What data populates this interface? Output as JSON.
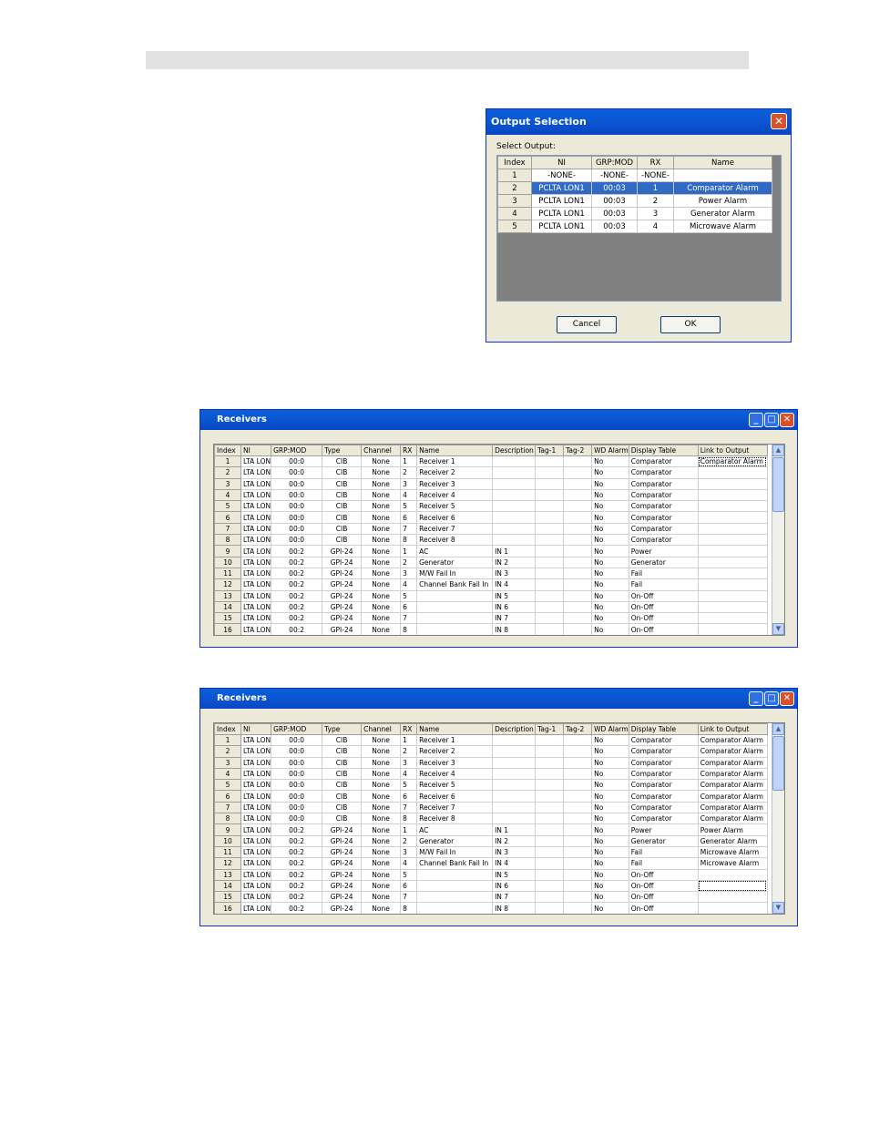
{
  "output_dialog": {
    "title": "Output Selection",
    "label": "Select Output:",
    "columns": [
      "Index",
      "NI",
      "GRP:MOD",
      "RX",
      "Name"
    ],
    "rows": [
      [
        "1",
        "-NONE-",
        "-NONE-",
        "-NONE-",
        ""
      ],
      [
        "2",
        "PCLTA LON1",
        "00:03",
        "1",
        "Comparator Alarm"
      ],
      [
        "3",
        "PCLTA LON1",
        "00:03",
        "2",
        "Power Alarm"
      ],
      [
        "4",
        "PCLTA LON1",
        "00:03",
        "3",
        "Generator Alarm"
      ],
      [
        "5",
        "PCLTA LON1",
        "00:03",
        "4",
        "Microwave Alarm"
      ]
    ],
    "selected_row": 2,
    "cancel_label": "Cancel",
    "ok_label": "OK"
  },
  "receivers_1": {
    "title": "Receivers",
    "columns": [
      "Index",
      "NI",
      "GRP:MOD",
      "Type",
      "Channel",
      "RX",
      "Name",
      "Description",
      "Tag-1",
      "Tag-2",
      "WD Alarm",
      "Display Table",
      "Link to Output"
    ],
    "rows": [
      [
        "1",
        "LTA LON",
        "00:0",
        "CIB",
        "None",
        "1",
        "Receiver 1",
        "",
        "",
        "",
        "No",
        "Comparator",
        "Comparator Alarm"
      ],
      [
        "2",
        "LTA LON",
        "00:0",
        "CIB",
        "None",
        "2",
        "Receiver 2",
        "",
        "",
        "",
        "No",
        "Comparator",
        ""
      ],
      [
        "3",
        "LTA LON",
        "00:0",
        "CIB",
        "None",
        "3",
        "Receiver 3",
        "",
        "",
        "",
        "No",
        "Comparator",
        ""
      ],
      [
        "4",
        "LTA LON",
        "00:0",
        "CIB",
        "None",
        "4",
        "Receiver 4",
        "",
        "",
        "",
        "No",
        "Comparator",
        ""
      ],
      [
        "5",
        "LTA LON",
        "00:0",
        "CIB",
        "None",
        "5",
        "Receiver 5",
        "",
        "",
        "",
        "No",
        "Comparator",
        ""
      ],
      [
        "6",
        "LTA LON",
        "00:0",
        "CIB",
        "None",
        "6",
        "Receiver 6",
        "",
        "",
        "",
        "No",
        "Comparator",
        ""
      ],
      [
        "7",
        "LTA LON",
        "00:0",
        "CIB",
        "None",
        "7",
        "Receiver 7",
        "",
        "",
        "",
        "No",
        "Comparator",
        ""
      ],
      [
        "8",
        "LTA LON",
        "00:0",
        "CIB",
        "None",
        "8",
        "Receiver 8",
        "",
        "",
        "",
        "No",
        "Comparator",
        ""
      ],
      [
        "9",
        "LTA LON",
        "00:2",
        "GPI-24",
        "None",
        "1",
        "AC",
        "IN 1",
        "",
        "",
        "No",
        "Power",
        ""
      ],
      [
        "10",
        "LTA LON",
        "00:2",
        "GPI-24",
        "None",
        "2",
        "Generator",
        "IN 2",
        "",
        "",
        "No",
        "Generator",
        ""
      ],
      [
        "11",
        "LTA LON",
        "00:2",
        "GPI-24",
        "None",
        "3",
        "M/W Fail In",
        "IN 3",
        "",
        "",
        "No",
        "Fail",
        ""
      ],
      [
        "12",
        "LTA LON",
        "00:2",
        "GPI-24",
        "None",
        "4",
        "Channel Bank Fail In",
        "IN 4",
        "",
        "",
        "No",
        "Fail",
        ""
      ],
      [
        "13",
        "LTA LON",
        "00:2",
        "GPI-24",
        "None",
        "5",
        "",
        "IN 5",
        "",
        "",
        "No",
        "On-Off",
        ""
      ],
      [
        "14",
        "LTA LON",
        "00:2",
        "GPI-24",
        "None",
        "6",
        "",
        "IN 6",
        "",
        "",
        "No",
        "On-Off",
        ""
      ],
      [
        "15",
        "LTA LON",
        "00:2",
        "GPI-24",
        "None",
        "7",
        "",
        "IN 7",
        "",
        "",
        "No",
        "On-Off",
        ""
      ],
      [
        "16",
        "LTA LON",
        "00:2",
        "GPI-24",
        "None",
        "8",
        "",
        "IN 8",
        "",
        "",
        "No",
        "On-Off",
        ""
      ]
    ]
  },
  "receivers_2": {
    "title": "Receivers",
    "columns": [
      "Index",
      "NI",
      "GRP:MOD",
      "Type",
      "Channel",
      "RX",
      "Name",
      "Description",
      "Tag-1",
      "Tag-2",
      "WD Alarm",
      "Display Table",
      "Link to Output"
    ],
    "rows": [
      [
        "1",
        "LTA LON",
        "00:0",
        "CIB",
        "None",
        "1",
        "Receiver 1",
        "",
        "",
        "",
        "No",
        "Comparator",
        "Comparator Alarm"
      ],
      [
        "2",
        "LTA LON",
        "00:0",
        "CIB",
        "None",
        "2",
        "Receiver 2",
        "",
        "",
        "",
        "No",
        "Comparator",
        "Comparator Alarm"
      ],
      [
        "3",
        "LTA LON",
        "00:0",
        "CIB",
        "None",
        "3",
        "Receiver 3",
        "",
        "",
        "",
        "No",
        "Comparator",
        "Comparator Alarm"
      ],
      [
        "4",
        "LTA LON",
        "00:0",
        "CIB",
        "None",
        "4",
        "Receiver 4",
        "",
        "",
        "",
        "No",
        "Comparator",
        "Comparator Alarm"
      ],
      [
        "5",
        "LTA LON",
        "00:0",
        "CIB",
        "None",
        "5",
        "Receiver 5",
        "",
        "",
        "",
        "No",
        "Comparator",
        "Comparator Alarm"
      ],
      [
        "6",
        "LTA LON",
        "00:0",
        "CIB",
        "None",
        "6",
        "Receiver 6",
        "",
        "",
        "",
        "No",
        "Comparator",
        "Comparator Alarm"
      ],
      [
        "7",
        "LTA LON",
        "00:0",
        "CIB",
        "None",
        "7",
        "Receiver 7",
        "",
        "",
        "",
        "No",
        "Comparator",
        "Comparator Alarm"
      ],
      [
        "8",
        "LTA LON",
        "00:0",
        "CIB",
        "None",
        "8",
        "Receiver 8",
        "",
        "",
        "",
        "No",
        "Comparator",
        "Comparator Alarm"
      ],
      [
        "9",
        "LTA LON",
        "00:2",
        "GPI-24",
        "None",
        "1",
        "AC",
        "IN 1",
        "",
        "",
        "No",
        "Power",
        "Power Alarm"
      ],
      [
        "10",
        "LTA LON",
        "00:2",
        "GPI-24",
        "None",
        "2",
        "Generator",
        "IN 2",
        "",
        "",
        "No",
        "Generator",
        "Generator Alarm"
      ],
      [
        "11",
        "LTA LON",
        "00:2",
        "GPI-24",
        "None",
        "3",
        "M/W Fail In",
        "IN 3",
        "",
        "",
        "No",
        "Fail",
        "Microwave Alarm"
      ],
      [
        "12",
        "LTA LON",
        "00:2",
        "GPI-24",
        "None",
        "4",
        "Channel Bank Fail In",
        "IN 4",
        "",
        "",
        "No",
        "Fail",
        "Microwave Alarm"
      ],
      [
        "13",
        "LTA LON",
        "00:2",
        "GPI-24",
        "None",
        "5",
        "",
        "IN 5",
        "",
        "",
        "No",
        "On-Off",
        ""
      ],
      [
        "14",
        "LTA LON",
        "00:2",
        "GPI-24",
        "None",
        "6",
        "",
        "IN 6",
        "",
        "",
        "No",
        "On-Off",
        ""
      ],
      [
        "15",
        "LTA LON",
        "00:2",
        "GPI-24",
        "None",
        "7",
        "",
        "IN 7",
        "",
        "",
        "No",
        "On-Off",
        ""
      ],
      [
        "16",
        "LTA LON",
        "00:2",
        "GPI-24",
        "None",
        "8",
        "",
        "IN 8",
        "",
        "",
        "No",
        "On-Off",
        ""
      ]
    ]
  },
  "icons": {
    "close": "close-icon",
    "minimize": "minimize-icon",
    "maximize": "maximize-icon",
    "scroll_up": "scroll-up-icon",
    "scroll_down": "scroll-down-icon"
  },
  "colors": {
    "title_bar": "#0a5fd8",
    "selection": "#316ac5",
    "close_button": "#d8512b",
    "dialog_face": "#ece9d8"
  }
}
